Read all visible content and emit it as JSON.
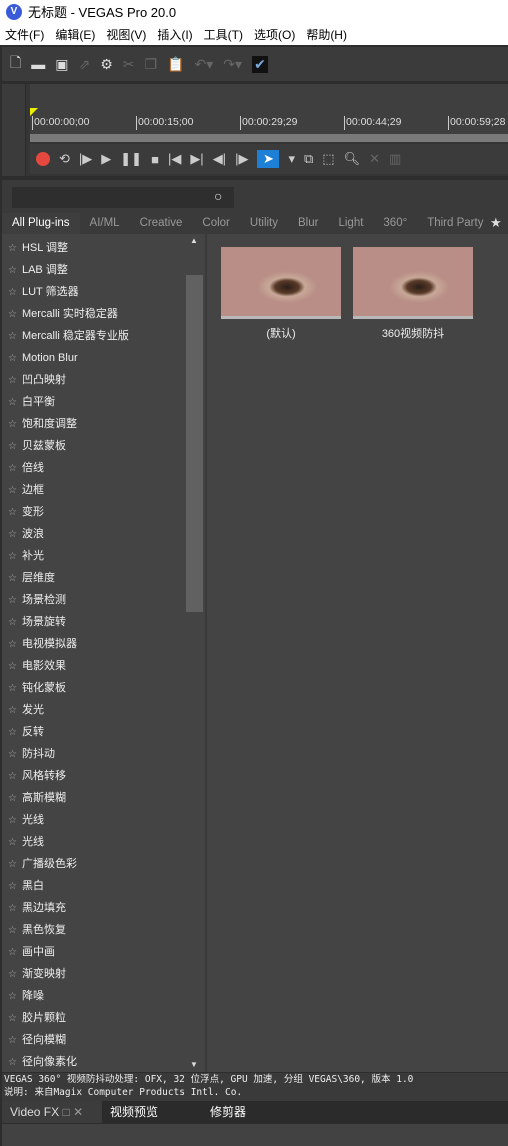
{
  "window": {
    "title": "无标题 - VEGAS Pro 20.0",
    "logo": "V"
  },
  "menu": [
    "文件(F)",
    "编辑(E)",
    "视图(V)",
    "插入(I)",
    "工具(T)",
    "选项(O)",
    "帮助(H)"
  ],
  "timeline": {
    "ticks": [
      "00:00:00;00",
      "00:00:15;00",
      "00:00:29;29",
      "00:00:44;29",
      "00:00:59;28"
    ]
  },
  "search": {
    "placeholder": "",
    "value": ""
  },
  "tabs": [
    "All Plug-ins",
    "AI/ML",
    "Creative",
    "Color",
    "Utility",
    "Blur",
    "Light",
    "360°",
    "Third Party"
  ],
  "active_tab": "All Plug-ins",
  "plugins": [
    "HSL 调整",
    "LAB 调整",
    "LUT 筛选器",
    "Mercalli 实时稳定器",
    "Mercalli 稳定器专业版",
    "Motion Blur",
    "凹凸映射",
    "白平衡",
    "饱和度调整",
    "贝兹蒙板",
    "倍线",
    "边框",
    "变形",
    "波浪",
    "补光",
    "层维度",
    "场景检测",
    "场景旋转",
    "电视模拟器",
    "电影效果",
    "钝化蒙板",
    "发光",
    "反转",
    "防抖动",
    "风格转移",
    "高斯模糊",
    "光线",
    "光线",
    "广播级色彩",
    "黑白",
    "黑边填充",
    "黑色恢复",
    "画中画",
    "渐变映射",
    "降噪",
    "胶片颗粒",
    "径向模糊",
    "径向像素化"
  ],
  "presets": [
    {
      "label": "(默认)"
    },
    {
      "label": "360视频防抖"
    }
  ],
  "status": {
    "line1": "VEGAS 360° 视频防抖动处理: OFX, 32 位浮点, GPU 加速, 分组 VEGAS\\360, 版本 1.0",
    "line2": "说明: 来自Magix Computer Products Intl. Co."
  },
  "bottom_tabs": [
    "Video FX",
    "视频预览",
    "修剪器"
  ],
  "colors": {
    "accent": "#1e7fd6",
    "record": "#e5483f",
    "panel": "#444444"
  }
}
